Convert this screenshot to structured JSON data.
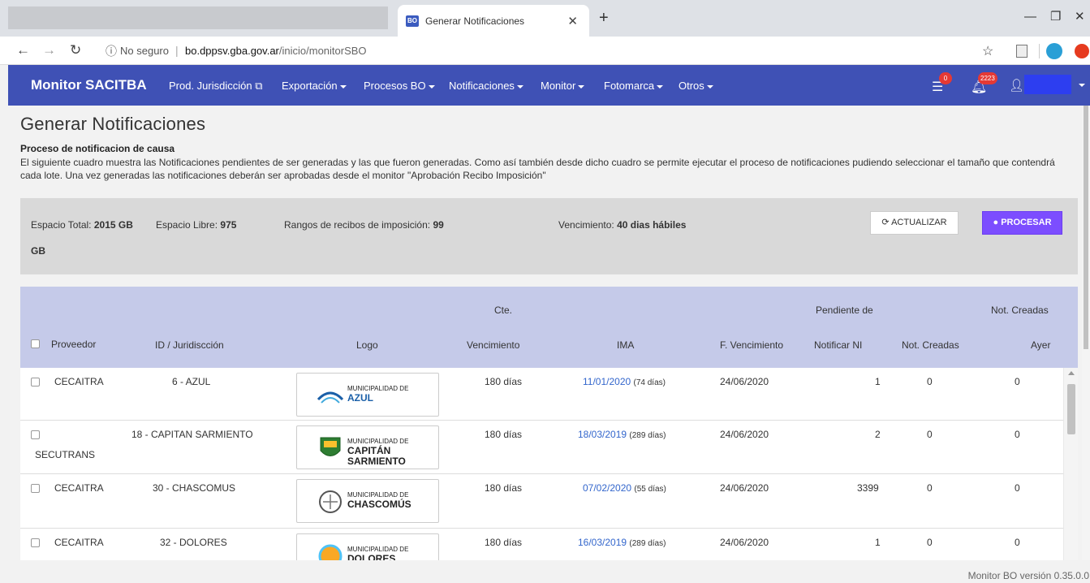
{
  "browser": {
    "tab_title": "Generar Notificaciones",
    "tab_favicon": "BO",
    "url_security": "No seguro",
    "url_host": "bo.dppsv.gba.gov.ar",
    "url_path": "/inicio/monitorSBO"
  },
  "navbar": {
    "brand": "Monitor SACITBA",
    "items": [
      {
        "label": "Prod. Jurisdicción",
        "icon": "external-link-icon"
      },
      {
        "label": "Exportación"
      },
      {
        "label": "Procesos BO"
      },
      {
        "label": "Notificaciones"
      },
      {
        "label": "Monitor"
      },
      {
        "label": "Fotomarca"
      },
      {
        "label": "Otros"
      }
    ],
    "tasks_badge": "0",
    "notifications_badge": "2223",
    "accent_color": "#3f51b5"
  },
  "page": {
    "title": "Generar Notificaciones",
    "section_title": "Proceso de notificacion de causa",
    "description": "El siguiente cuadro muestra las Notificaciones pendientes de ser generadas y las que fueron generadas. Como así también desde dicho cuadro se permite ejecutar el proceso de notificaciones pudiendo seleccionar el tamaño que contendrá cada lote. Una vez generadas las notificaciones deberán ser aprobadas desde el monitor \"Aprobación Recibo Imposición\""
  },
  "info": {
    "espacio_total_label": "Espacio Total:",
    "espacio_total_value": "2015 GB",
    "espacio_libre_label": "Espacio Libre:",
    "espacio_libre_value": "975",
    "espacio_libre_unit": "GB",
    "rangos_label": "Rangos de recibos de imposición:",
    "rangos_value": "99",
    "vencimiento_label": "Vencimiento:",
    "vencimiento_value": "40 dias hábiles",
    "actualizar_label": "ACTUALIZAR",
    "procesar_label": "PROCESAR"
  },
  "table": {
    "headers": {
      "proveedor": "Proveedor",
      "id_jurisdiccion": "ID / Juridiscción",
      "logo": "Logo",
      "cte_vencimiento_top": "Cte.",
      "cte_vencimiento_bottom": "Vencimiento",
      "ima": "IMA",
      "f_vencimiento": "F. Vencimiento",
      "pendiente_top": "Pendiente de",
      "pendiente_bottom": "Notificar NI",
      "not_creadas": "Not. Creadas",
      "not_creadas_ayer_top": "Not. Creadas",
      "not_creadas_ayer_bottom": "Ayer"
    },
    "rows": [
      {
        "proveedor": "CECAITRA",
        "jurisdiccion": "6 - AZUL",
        "logo_line1": "Municipalidad de",
        "logo_line2": "Azul",
        "vencimiento": "180 días",
        "ima_date": "11/01/2020",
        "ima_days": "(74 días)",
        "f_vencimiento": "24/06/2020",
        "pendiente": "1",
        "not_creadas": "0",
        "not_creadas_ayer": "0"
      },
      {
        "proveedor": "SECUTRANS",
        "jurisdiccion": "18 - CAPITAN SARMIENTO",
        "logo_line1": "Municipalidad de",
        "logo_line2": "Capitán Sarmiento",
        "vencimiento": "180 días",
        "ima_date": "18/03/2019",
        "ima_days": "(289 días)",
        "f_vencimiento": "24/06/2020",
        "pendiente": "2",
        "not_creadas": "0",
        "not_creadas_ayer": "0"
      },
      {
        "proveedor": "CECAITRA",
        "jurisdiccion": "30 - CHASCOMUS",
        "logo_line1": "Municipalidad de",
        "logo_line2": "Chascomús",
        "vencimiento": "180 días",
        "ima_date": "07/02/2020",
        "ima_days": "(55 días)",
        "f_vencimiento": "24/06/2020",
        "pendiente": "3399",
        "not_creadas": "0",
        "not_creadas_ayer": "0"
      },
      {
        "proveedor": "CECAITRA",
        "jurisdiccion": "32 - DOLORES",
        "logo_line1": "Municipalidad de",
        "logo_line2": "Dolores",
        "vencimiento": "180 días",
        "ima_date": "16/03/2019",
        "ima_days": "(289 días)",
        "f_vencimiento": "24/06/2020",
        "pendiente": "1",
        "not_creadas": "0",
        "not_creadas_ayer": "0"
      }
    ]
  },
  "footer": {
    "version": "Monitor BO versión 0.35.0.0"
  }
}
